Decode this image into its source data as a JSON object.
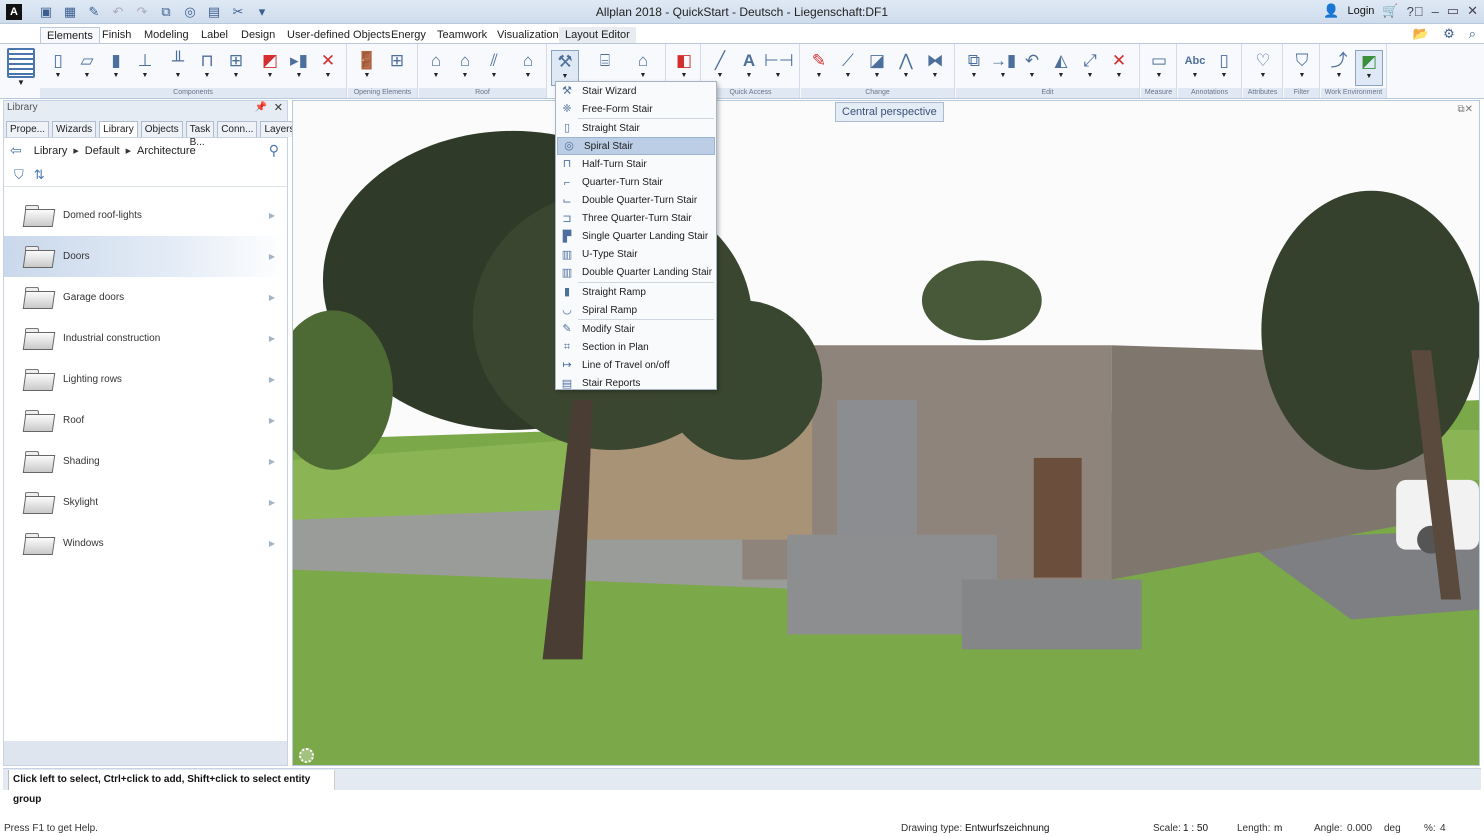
{
  "app": {
    "title": "Allplan 2018 - QuickStart - Deutsch - Liegenschaft:DF1",
    "logo": "A",
    "login_label": "Login",
    "title_icons": [
      "user-icon",
      "cart-icon",
      "help-icon",
      "minimize-icon",
      "maximize-icon",
      "close-icon"
    ]
  },
  "quick_access_toolbar": [
    "project-icon",
    "layout-icon",
    "edit-icon",
    "undo-icon",
    "redo-icon",
    "redraw-icon",
    "view-icon",
    "window-icon",
    "tools-icon",
    "customize-icon"
  ],
  "ribbon": {
    "tabs": [
      "Elements",
      "Finish",
      "Modeling",
      "Label",
      "Design",
      "User-defined Objects",
      "Energy",
      "Teamwork",
      "Visualization",
      "Layout Editor"
    ],
    "active_tab": "Elements",
    "right_icons": [
      "open-project-icon",
      "settings-icon",
      "search-icon"
    ],
    "groups": [
      {
        "label": "Components",
        "tools": [
          "wall",
          "slab",
          "column",
          "foundation",
          "downstand-beam",
          "lintel",
          "grid",
          "opening-text",
          "rotate-element",
          "delete-opening"
        ]
      },
      {
        "label": "Opening Elements",
        "tools": [
          "door",
          "window"
        ]
      },
      {
        "label": "Roof",
        "tools": [
          "roof",
          "gable-roof",
          "rafters",
          "roof-plane"
        ]
      },
      {
        "label": "",
        "tools": [
          "stair",
          "railing",
          "gate"
        ]
      },
      {
        "label": "",
        "tools": [
          "facade"
        ]
      },
      {
        "label": "Quick Access",
        "tools": [
          "line",
          "text",
          "dimension"
        ]
      },
      {
        "label": "Change",
        "tools": [
          "modify",
          "trim",
          "replace",
          "polyline",
          "join"
        ]
      },
      {
        "label": "Edit",
        "tools": [
          "copy",
          "move",
          "rotate",
          "mirror",
          "stretch",
          "delete"
        ]
      },
      {
        "label": "Measure",
        "tools": [
          "measure"
        ]
      },
      {
        "label": "Annotations",
        "tools": [
          "text-abc",
          "label"
        ]
      },
      {
        "label": "Attributes",
        "tools": [
          "attributes"
        ]
      },
      {
        "label": "Filter",
        "tools": [
          "filter"
        ]
      },
      {
        "label": "Work Environment",
        "tools": [
          "navigation",
          "view-toggle"
        ]
      }
    ]
  },
  "stair_menu": {
    "items": [
      {
        "label": "Stair Wizard",
        "icon": "stair-wizard-icon"
      },
      {
        "label": "Free-Form Stair",
        "icon": "free-form-stair-icon"
      },
      {
        "label": "Straight Stair",
        "icon": "straight-stair-icon"
      },
      {
        "label": "Spiral Stair",
        "icon": "spiral-stair-icon",
        "selected": true
      },
      {
        "label": "Half-Turn Stair",
        "icon": "half-turn-stair-icon"
      },
      {
        "label": "Quarter-Turn Stair",
        "icon": "quarter-turn-stair-icon"
      },
      {
        "label": "Double Quarter-Turn Stair",
        "icon": "double-quarter-turn-stair-icon"
      },
      {
        "label": "Three Quarter-Turn Stair",
        "icon": "three-quarter-turn-stair-icon"
      },
      {
        "label": "Single Quarter Landing Stair",
        "icon": "single-quarter-landing-stair-icon"
      },
      {
        "label": "U-Type Stair",
        "icon": "u-type-stair-icon"
      },
      {
        "label": "Double Quarter Landing Stair",
        "icon": "double-quarter-landing-stair-icon"
      },
      {
        "label": "Straight Ramp",
        "icon": "straight-ramp-icon"
      },
      {
        "label": "Spiral Ramp",
        "icon": "spiral-ramp-icon"
      },
      {
        "label": "Modify Stair",
        "icon": "modify-stair-icon"
      },
      {
        "label": "Section in Plan",
        "icon": "section-in-plan-icon"
      },
      {
        "label": "Line of Travel on/off",
        "icon": "line-of-travel-icon"
      },
      {
        "label": "Stair Reports",
        "icon": "stair-reports-icon"
      }
    ]
  },
  "library_panel": {
    "title": "Library",
    "tabs": [
      "Prope...",
      "Wizards",
      "Library",
      "Objects",
      "Task B...",
      "Conn...",
      "Layers"
    ],
    "active_tab": "Library",
    "breadcrumb": [
      "Library",
      "Default",
      "Architecture"
    ],
    "items": [
      "Domed roof-lights",
      "Doors",
      "Garage doors",
      "Industrial construction",
      "Lighting rows",
      "Roof",
      "Shading",
      "Skylight",
      "Windows"
    ],
    "hovered_item": "Doors"
  },
  "viewport": {
    "view_label": "Central perspective"
  },
  "command_bar": {
    "prompt": "Click left to select, Ctrl+click to add, Shift+click to select entity group"
  },
  "status_bar": {
    "help": "Press F1 to get Help.",
    "drawing_type_label": "Drawing type:",
    "drawing_type": "Entwurfszeichnung",
    "scale_label": "Scale:",
    "scale": "1 : 50",
    "length_label": "Length:",
    "length_unit": "m",
    "angle_label": "Angle:",
    "angle": "0.000",
    "angle_unit": "deg",
    "percent_label": "%:",
    "percent": "4"
  },
  "colors": {
    "accent": "#4a76b0",
    "menu_selected": "#bccde6",
    "ribbon_bg": "#f7f9fc",
    "titlebar": "#dfe9f5"
  }
}
